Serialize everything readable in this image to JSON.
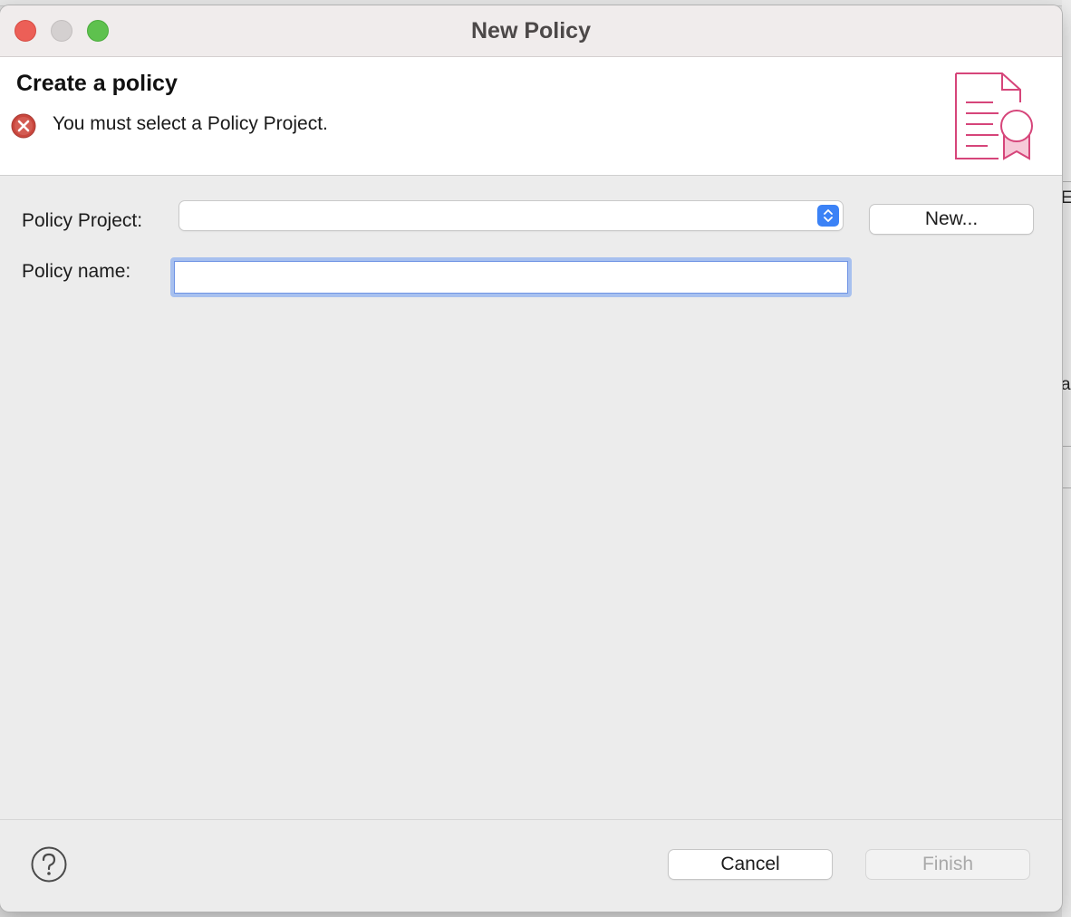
{
  "window": {
    "title": "New Policy"
  },
  "header": {
    "title": "Create a policy",
    "error_message": "You must select a Policy Project.",
    "error_icon": "error-x-icon",
    "graphic_icon": "policy-certificate-icon",
    "accent_color": "#d6457a"
  },
  "form": {
    "policy_project": {
      "label": "Policy Project:",
      "selected_value": "",
      "new_button_label": "New..."
    },
    "policy_name": {
      "label": "Policy name:",
      "value": "",
      "placeholder": ""
    }
  },
  "footer": {
    "help_icon": "help-question-icon",
    "cancel_label": "Cancel",
    "finish_label": "Finish",
    "finish_enabled": false
  },
  "background": {
    "edge_chars": [
      "E",
      "a"
    ]
  },
  "colors": {
    "focus_ring": "#a7c0ef",
    "select_stepper": "#3b82f6",
    "close": "#ec5f57",
    "minimize": "#d4d0d0",
    "zoom": "#5ec14e"
  }
}
